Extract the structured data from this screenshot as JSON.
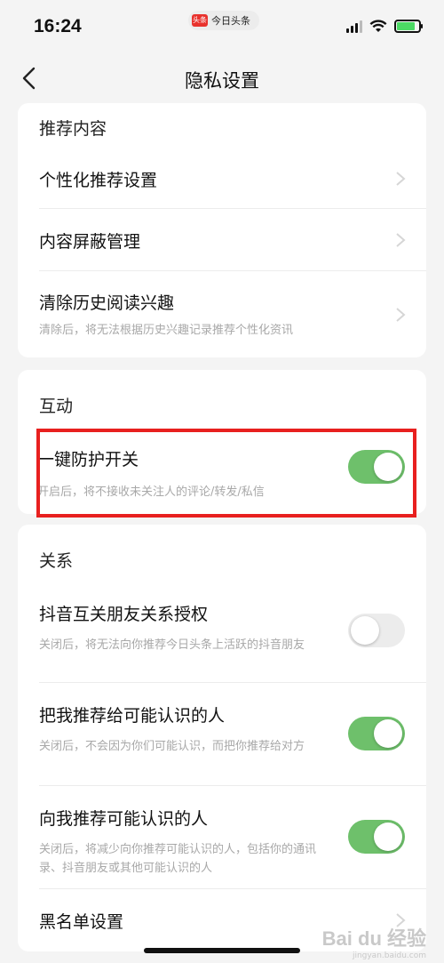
{
  "status_bar": {
    "time": "16:24",
    "app_name": "今日头条",
    "app_logo_text": "头条"
  },
  "nav": {
    "title": "隐私设置"
  },
  "recommend": {
    "title": "推荐内容",
    "items": [
      {
        "label": "个性化推荐设置"
      },
      {
        "label": "内容屏蔽管理"
      },
      {
        "label": "清除历史阅读兴趣",
        "desc": "清除后，将无法根据历史兴趣记录推荐个性化资讯"
      }
    ]
  },
  "interaction": {
    "title": "互动",
    "items": [
      {
        "label": "一键防护开关",
        "desc": "开启后，将不接收未关注人的评论/转发/私信",
        "enabled": true
      }
    ]
  },
  "relation": {
    "title": "关系",
    "items": [
      {
        "label": "抖音互关朋友关系授权",
        "desc": "关闭后，将无法向你推荐今日头条上活跃的抖音朋友",
        "enabled": false
      },
      {
        "label": "把我推荐给可能认识的人",
        "desc": "关闭后，不会因为你们可能认识，而把你推荐给对方",
        "enabled": true
      },
      {
        "label": "向我推荐可能认识的人",
        "desc": "关闭后，将减少向你推荐可能认识的人，包括你的通讯录、抖音朋友或其他可能认识的人",
        "enabled": true
      },
      {
        "label": "黑名单设置"
      }
    ]
  },
  "watermark": {
    "logo": "Bai du 经验",
    "url": "jingyan.baidu.com"
  },
  "colors": {
    "toggle_on": "#6ec06b",
    "toggle_off": "#ececec",
    "highlight": "#e8201f"
  }
}
